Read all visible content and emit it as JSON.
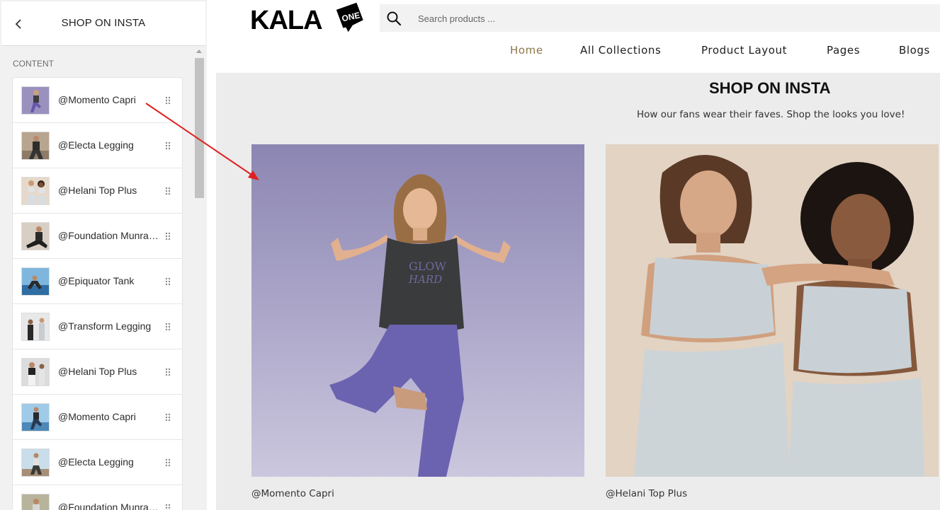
{
  "editor": {
    "back_icon": "chevron-left-icon",
    "title": "SHOP ON INSTA",
    "content_label": "CONTENT",
    "items": [
      {
        "label": "@Momento Capri"
      },
      {
        "label": "@Electa Legging"
      },
      {
        "label": "@Helani Top Plus"
      },
      {
        "label": "@Foundation Munrap Tank"
      },
      {
        "label": "@Epiquator Tank"
      },
      {
        "label": "@Transform Legging"
      },
      {
        "label": "@Helani Top Plus"
      },
      {
        "label": "@Momento Capri"
      },
      {
        "label": "@Electa Legging"
      },
      {
        "label": "@Foundation Munrap Tank"
      }
    ]
  },
  "store": {
    "logo_text": "KALA",
    "logo_badge": "ONE",
    "search": {
      "placeholder": "Search products ..."
    },
    "nav": [
      {
        "label": "Home",
        "active": true
      },
      {
        "label": "All Collections",
        "active": false
      },
      {
        "label": "Product Layout",
        "active": false
      },
      {
        "label": "Pages",
        "active": false
      },
      {
        "label": "Blogs",
        "active": false
      }
    ],
    "accent_color": "#8e7648"
  },
  "section": {
    "title": "SHOP ON INSTA",
    "subtitle": "How our fans wear their faves. Shop the looks you love!",
    "cards": [
      {
        "caption": "@Momento Capri",
        "shirt_text_1": "GLOW",
        "shirt_text_2": "HARD"
      },
      {
        "caption": "@Helani Top Plus"
      }
    ]
  },
  "annotation": {
    "color": "#e02020"
  }
}
